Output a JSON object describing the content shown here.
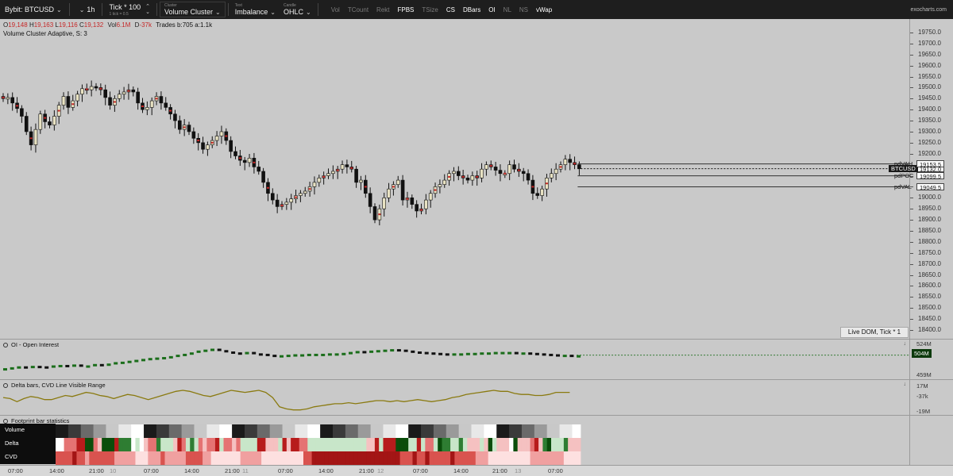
{
  "toolbar": {
    "symbol": "Bybit: BTCUSD",
    "timeframe": "1h",
    "tick": "Tick * 100",
    "tick_sub": "1 tick = 0.5",
    "cluster_caption": "Cluster",
    "cluster_value": "Volume Cluster",
    "text_caption": "Text",
    "text_value": "Imbalance",
    "candle_caption": "Candle",
    "candle_value": "OHLC",
    "toggles": [
      {
        "label": "Vol",
        "on": false
      },
      {
        "label": "TCount",
        "on": false
      },
      {
        "label": "Rekt",
        "on": false
      },
      {
        "label": "FPBS",
        "on": true
      },
      {
        "label": "TSize",
        "on": false
      },
      {
        "label": "CS",
        "on": true
      },
      {
        "label": "DBars",
        "on": true
      },
      {
        "label": "OI",
        "on": true
      },
      {
        "label": "NL",
        "on": false
      },
      {
        "label": "NS",
        "on": false
      },
      {
        "label": "vWap",
        "on": true
      }
    ],
    "brand": "exocharts.com"
  },
  "legend": {
    "o_key": "O",
    "o_val": "19,148",
    "h_key": "H",
    "h_val": "19,163",
    "l_key": "L",
    "l_val": "19,116",
    "c_key": "C",
    "c_val": "19,132",
    "vol_key": "Vol",
    "vol_val": "6.1M",
    "d_key": "D",
    "d_val": "-37k",
    "trades": "Trades b:705 a:1.1k",
    "study": "Volume Cluster Adaptive, S: 3"
  },
  "price_scale": {
    "labels": [
      "19750.0",
      "19700.0",
      "19650.0",
      "19600.0",
      "19550.0",
      "19500.0",
      "19450.0",
      "19400.0",
      "19350.0",
      "19300.0",
      "19250.0",
      "19200.0",
      "19150.0",
      "19100.0",
      "19050.0",
      "19000.0",
      "18950.0",
      "18900.0",
      "18850.0",
      "18800.0",
      "18750.0",
      "18700.0",
      "18650.0",
      "18600.0",
      "18550.0",
      "18500.0",
      "18450.0",
      "18400.0"
    ],
    "hi": 19775,
    "lo": 18400
  },
  "levels": [
    {
      "name": "pdVAH",
      "value": "19153.5",
      "style": "light",
      "price": 19153.5
    },
    {
      "name": "BTCUSD",
      "value": "19132.0",
      "style": "dark",
      "price": 19132.0
    },
    {
      "name": "pdPOC",
      "value": "19099.5",
      "style": "light",
      "price": 19099.5
    },
    {
      "name": "pdVAL",
      "value": "19049.5",
      "style": "light",
      "price": 19049.5
    }
  ],
  "live_dom": "Live DOM, Tick * 1",
  "panes": {
    "oi": {
      "title": "OI - Open Interest",
      "top_scale": "524M",
      "current": "504M",
      "bottom_scale": "459M"
    },
    "delta": {
      "title": "Delta bars, CVD Line Visible Range",
      "top_scale": "17M",
      "current": "-37k",
      "bottom_scale": "-19M"
    },
    "stats": {
      "title": "Footprint bar statistics",
      "rows": [
        "Volume",
        "Delta",
        "CVD"
      ]
    }
  },
  "chart_data": {
    "type": "candlestick",
    "title": "",
    "xlabel": "",
    "ylabel": "",
    "ylim": [
      18400,
      19775
    ],
    "closes": [
      19450,
      19455,
      19430,
      19405,
      19370,
      19300,
      19240,
      19310,
      19380,
      19345,
      19330,
      19370,
      19420,
      19460,
      19410,
      19440,
      19470,
      19495,
      19490,
      19505,
      19500,
      19490,
      19455,
      19420,
      19450,
      19470,
      19480,
      19490,
      19480,
      19430,
      19400,
      19410,
      19440,
      19460,
      19430,
      19410,
      19380,
      19350,
      19310,
      19330,
      19300,
      19270,
      19250,
      19220,
      19240,
      19260,
      19280,
      19300,
      19260,
      19210,
      19190,
      19170,
      19160,
      19180,
      19140,
      19120,
      19070,
      19020,
      18990,
      18960,
      18970,
      18980,
      18995,
      19010,
      19020,
      19030,
      19050,
      19070,
      19090,
      19100,
      19110,
      19120,
      19130,
      19150,
      19140,
      19130,
      19070,
      19080,
      19020,
      18960,
      18900,
      18950,
      19000,
      19040,
      19060,
      19080,
      18990,
      19000,
      18970,
      18940,
      18950,
      18990,
      19020,
      19050,
      19060,
      19080,
      19110,
      19120,
      19100,
      19090,
      19080,
      19100,
      19090,
      19130,
      19150,
      19140,
      19125,
      19110,
      19110,
      19150,
      19130,
      19120,
      19110,
      19080,
      19020,
      19010,
      19040,
      19090,
      19110,
      19130,
      19150,
      19175,
      19160,
      19150,
      19132
    ],
    "oi": [
      476,
      478,
      480,
      477,
      481,
      480,
      479,
      482,
      483,
      481,
      484,
      480,
      482,
      485,
      484,
      486,
      489,
      490,
      492,
      494,
      496,
      498,
      499,
      500,
      502,
      505,
      507,
      510,
      514,
      516,
      518,
      515,
      512,
      510,
      509,
      511,
      508,
      507,
      505,
      503,
      504,
      505,
      506,
      506,
      507,
      507,
      507,
      508,
      508,
      509,
      511,
      513,
      512,
      514,
      515,
      516,
      517,
      516,
      514,
      512,
      511,
      510,
      509,
      508,
      507,
      508,
      508,
      509,
      509,
      510,
      510,
      511,
      511,
      511,
      510,
      510,
      509,
      508,
      507,
      506,
      505,
      505,
      504,
      504
    ],
    "cvd": [
      0.3,
      0.2,
      -0.1,
      0.2,
      0.4,
      0.3,
      0.1,
      0.1,
      0.3,
      0.5,
      0.4,
      0.6,
      0.8,
      0.7,
      0.5,
      0.4,
      0.2,
      0.4,
      0.6,
      0.5,
      0.3,
      0.1,
      0.3,
      0.5,
      0.7,
      0.9,
      1.0,
      0.9,
      0.7,
      0.5,
      0.4,
      0.6,
      0.8,
      1.0,
      0.9,
      0.8,
      0.9,
      1.0,
      0.8,
      0.3,
      -0.6,
      -0.8,
      -0.9,
      -0.9,
      -0.8,
      -0.6,
      -0.5,
      -0.4,
      -0.3,
      -0.3,
      -0.2,
      -0.3,
      -0.2,
      -0.1,
      0.0,
      0.0,
      -0.1,
      0.0,
      -0.1,
      0.0,
      0.1,
      0.0,
      -0.1,
      0.0,
      0.1,
      0.3,
      0.4,
      0.6,
      0.7,
      0.8,
      0.9,
      1.0,
      0.9,
      0.9,
      0.7,
      0.6,
      0.6,
      0.5,
      0.5,
      0.6,
      0.8,
      0.8,
      0.8
    ]
  },
  "time_axis": [
    {
      "label": "07:00",
      "day": false
    },
    {
      "label": "14:00",
      "day": false
    },
    {
      "label": "21:00",
      "day": false
    },
    {
      "label": "10",
      "day": true
    },
    {
      "label": "07:00",
      "day": false
    },
    {
      "label": "14:00",
      "day": false
    },
    {
      "label": "21:00",
      "day": false
    },
    {
      "label": "11",
      "day": true
    },
    {
      "label": "07:00",
      "day": false
    },
    {
      "label": "14:00",
      "day": false
    },
    {
      "label": "21:00",
      "day": false
    },
    {
      "label": "12",
      "day": true
    },
    {
      "label": "07:00",
      "day": false
    },
    {
      "label": "14:00",
      "day": false
    },
    {
      "label": "21:00",
      "day": false
    },
    {
      "label": "13",
      "day": true
    },
    {
      "label": "07:00",
      "day": false
    }
  ],
  "colors": {
    "up": "#e8e2c2",
    "down": "#111111",
    "oi_up": "#1b6e1b",
    "oi_down": "#111111",
    "cvd_line": "#8a7a10",
    "red": "#c62828",
    "green": "#1b6e1b"
  }
}
